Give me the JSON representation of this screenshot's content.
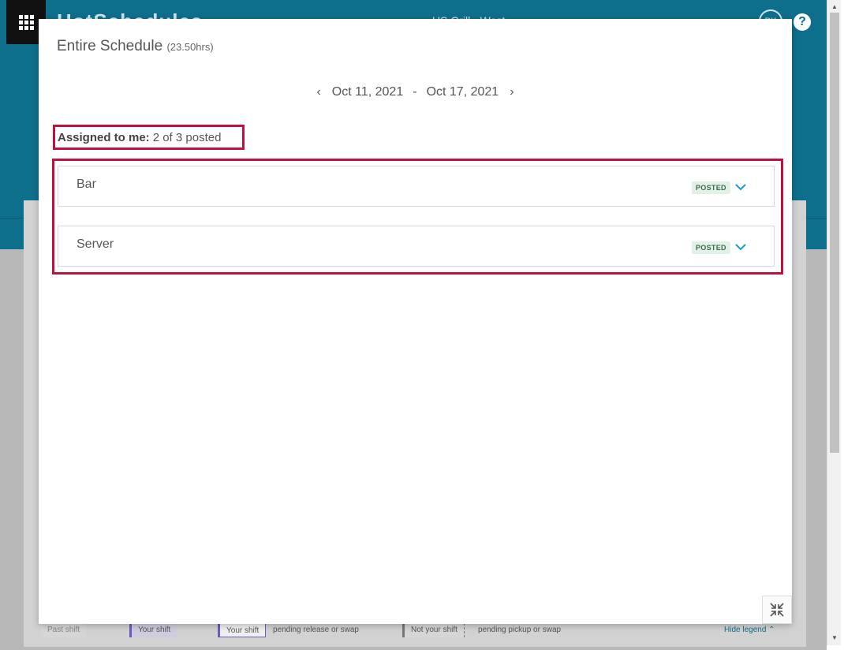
{
  "app": {
    "logo_text": "HotSchedules",
    "location": "US Grill - West",
    "avatar_initials": "RK",
    "help_glyph": "?"
  },
  "legend": {
    "past_shift": "Past shift",
    "your_shift": "Your shift",
    "your_shift_pending": "Your shift",
    "pending_release": "pending release or swap",
    "not_your_shift": "Not your shift",
    "pending_pickup": "pending pickup or swap",
    "hide_legend": "Hide legend"
  },
  "modal": {
    "title": "Entire Schedule",
    "hours": "(23.50hrs)",
    "date_start": "Oct 11, 2021",
    "date_separator": "-",
    "date_end": "Oct 17, 2021",
    "prev_glyph": "‹",
    "next_glyph": "›",
    "assigned_label": "Assigned to me:",
    "assigned_value": "2 of 3 posted",
    "sections": [
      {
        "name": "Bar",
        "status": "POSTED"
      },
      {
        "name": "Server",
        "status": "POSTED"
      }
    ]
  },
  "colors": {
    "brand": "#0e6f8c",
    "highlight": "#c0103d",
    "badge_bg": "#e2f1e7",
    "chevron": "#1a9bd0"
  },
  "icons": {
    "apps": "apps-grid-icon",
    "help": "help-icon",
    "chevron": "chevron-down-icon",
    "collapse": "collapse-icon"
  }
}
